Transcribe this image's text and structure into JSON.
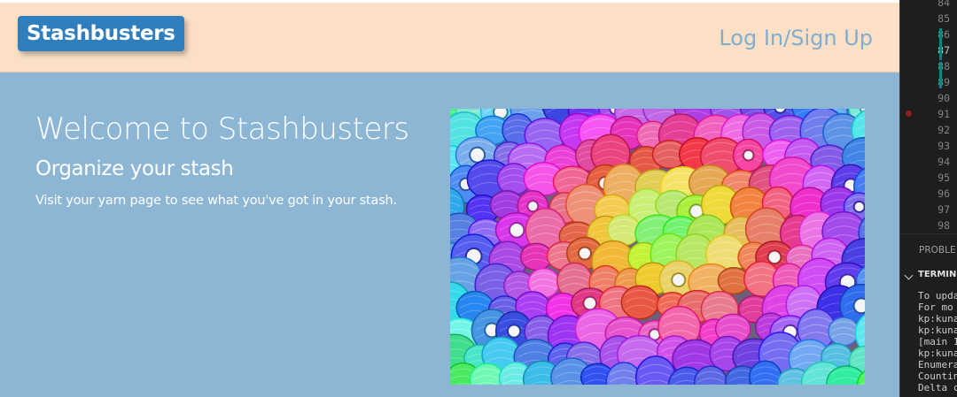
{
  "site": {
    "brand": "Stashbusters",
    "nav_login": "Log In/Sign Up",
    "hero_title": "Welcome to Stashbusters",
    "hero_subtitle": "Organize your stash",
    "hero_text": "Visit your yarn page to see what you've got in your stash.",
    "image_alt": "yarn-balls-photo"
  },
  "editor": {
    "line_numbers": [
      "84",
      "85",
      "86",
      "87",
      "88",
      "89",
      "90",
      "91",
      "92",
      "93",
      "94",
      "95",
      "96",
      "97",
      "98"
    ],
    "active_line": "87",
    "panel_tab": "PROBLE",
    "terminal_title": "TERMIN",
    "terminal_lines": [
      "To upda",
      "For mo",
      "kp:kuna",
      "kp:kuna",
      "[main 1",
      "kp:kuna",
      "Enumera",
      "Countin",
      "Delta c"
    ]
  },
  "colors": {
    "page_bg": "#8db6d4",
    "navbar_bg": "#fbe0c6",
    "brand_bg": "#2f7fbe",
    "login_text": "#7fadd2",
    "editor_bg": "#1e1e1e"
  }
}
